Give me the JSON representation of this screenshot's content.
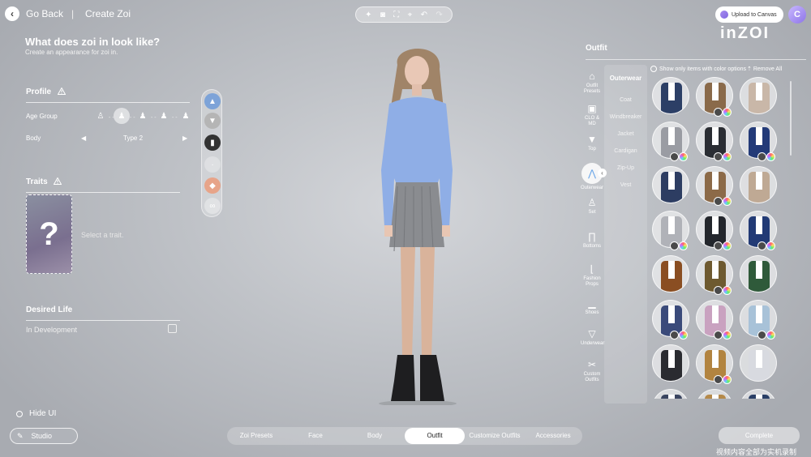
{
  "header": {
    "go_back": "Go Back",
    "separator": "|",
    "create_zoi": "Create Zoi",
    "upload_label": "Upload to Canvas",
    "user_initial": "C",
    "brand": "inZOI"
  },
  "toolbar_icons": [
    "sparkle-icon",
    "camera-icon",
    "frame-icon",
    "focus-icon",
    "undo-icon",
    "redo-icon"
  ],
  "left": {
    "title": "What does zoi in look like?",
    "subtitle": "Create an appearance for zoi in.",
    "profile": {
      "heading": "Profile",
      "age_group_label": "Age Group",
      "age_options": [
        "infant",
        "child",
        "teen",
        "adult",
        "elder"
      ],
      "age_selected": 1,
      "body_label": "Body",
      "body_value": "Type 2"
    },
    "traits": {
      "heading": "Traits",
      "placeholder_symbol": "?",
      "select_text": "Select a trait."
    },
    "desired_life": {
      "heading": "Desired Life",
      "value": "In Development"
    }
  },
  "outfit": {
    "title": "Outfit",
    "show_only_label": "Show only items with color options",
    "remove_all_label": "Remove All",
    "categories": [
      {
        "label": "Outfit Presets",
        "icon": "hanger-icon"
      },
      {
        "label": "CLO & MD",
        "icon": "cube-icon"
      },
      {
        "label": "Top",
        "icon": "tshirt-icon"
      },
      {
        "label": "Outerwear",
        "icon": "jacket-icon",
        "selected": true
      },
      {
        "label": "Set",
        "icon": "dress-icon"
      },
      {
        "label": "Bottoms",
        "icon": "pants-icon"
      },
      {
        "label": "Fashion Props",
        "icon": "boot-icon"
      },
      {
        "label": "Shoes",
        "icon": "shoe-icon"
      },
      {
        "label": "Underwear",
        "icon": "underwear-icon"
      },
      {
        "label": "Custom Outfits",
        "icon": "scissors-icon"
      }
    ],
    "sub_title": "Outerwear",
    "sub_items": [
      "Coat",
      "Windbreaker",
      "Jacket",
      "Cardigan",
      "Zip-Up",
      "Vest"
    ],
    "grid_colors": [
      "#2c3f66",
      "#8a6a4a",
      "#c9b7a8",
      "#9a9ca3",
      "#2a2d33",
      "#233a78",
      "#2d3d62",
      "#8c6a48",
      "#bfa994",
      "#b0b2b8",
      "#23262c",
      "#223a75",
      "#8a4e22",
      "#6e5a30",
      "#2f5a3a",
      "#3a4a7a",
      "#c9a2c0",
      "#a8c2d8",
      "#2a2b30",
      "#b28440",
      "#d8dae0",
      "#3a4560",
      "#b58a4a",
      "#2a3f66"
    ]
  },
  "bottom": {
    "hide_ui": "Hide UI",
    "studio": "Studio",
    "tabs": [
      "Zoi Presets",
      "Face",
      "Body",
      "Outfit",
      "Customize Outfits",
      "Accessories"
    ],
    "active_tab": "Outfit",
    "complete": "Complete",
    "watermark": "视频内容全部为实机录制"
  }
}
